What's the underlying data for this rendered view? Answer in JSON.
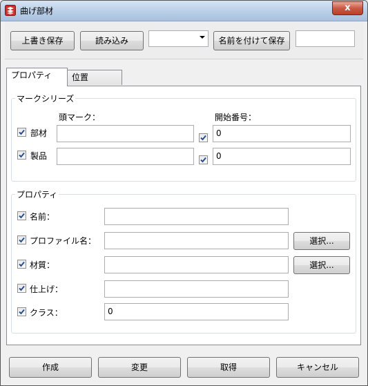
{
  "window": {
    "title": "曲げ部材",
    "close_glyph": "x"
  },
  "toolbar": {
    "save_label": "上書き保存",
    "load_label": "読み込み",
    "preset_value": "",
    "save_as_label": "名前を付けて保存",
    "save_as_name": ""
  },
  "tabs": [
    {
      "label": "プロパティ"
    },
    {
      "label": "位置"
    }
  ],
  "mark_series": {
    "title": "マークシリーズ",
    "prefix_header": "頭マーク：",
    "start_header": "開始番号：",
    "rows": [
      {
        "label": "部材",
        "prefix": "",
        "start": "0",
        "checked": true,
        "start_checked": true
      },
      {
        "label": "製品",
        "prefix": "",
        "start": "0",
        "checked": true,
        "start_checked": true
      }
    ]
  },
  "properties": {
    "title": "プロパティ",
    "select_label": "選択...",
    "rows": [
      {
        "label": "名前：",
        "value": "",
        "checked": true
      },
      {
        "label": "プロファイル名：",
        "value": "",
        "checked": true
      },
      {
        "label": "材質：",
        "value": "",
        "checked": true
      },
      {
        "label": "仕上げ：",
        "value": "",
        "checked": true
      },
      {
        "label": "クラス：",
        "value": "0",
        "checked": true
      }
    ]
  },
  "actions": {
    "create_label": "作成",
    "modify_label": "変更",
    "get_label": "取得",
    "cancel_label": "キャンセル"
  },
  "colors": {
    "check_mark": "#2a4f8f",
    "close_button": "#c75a44"
  }
}
